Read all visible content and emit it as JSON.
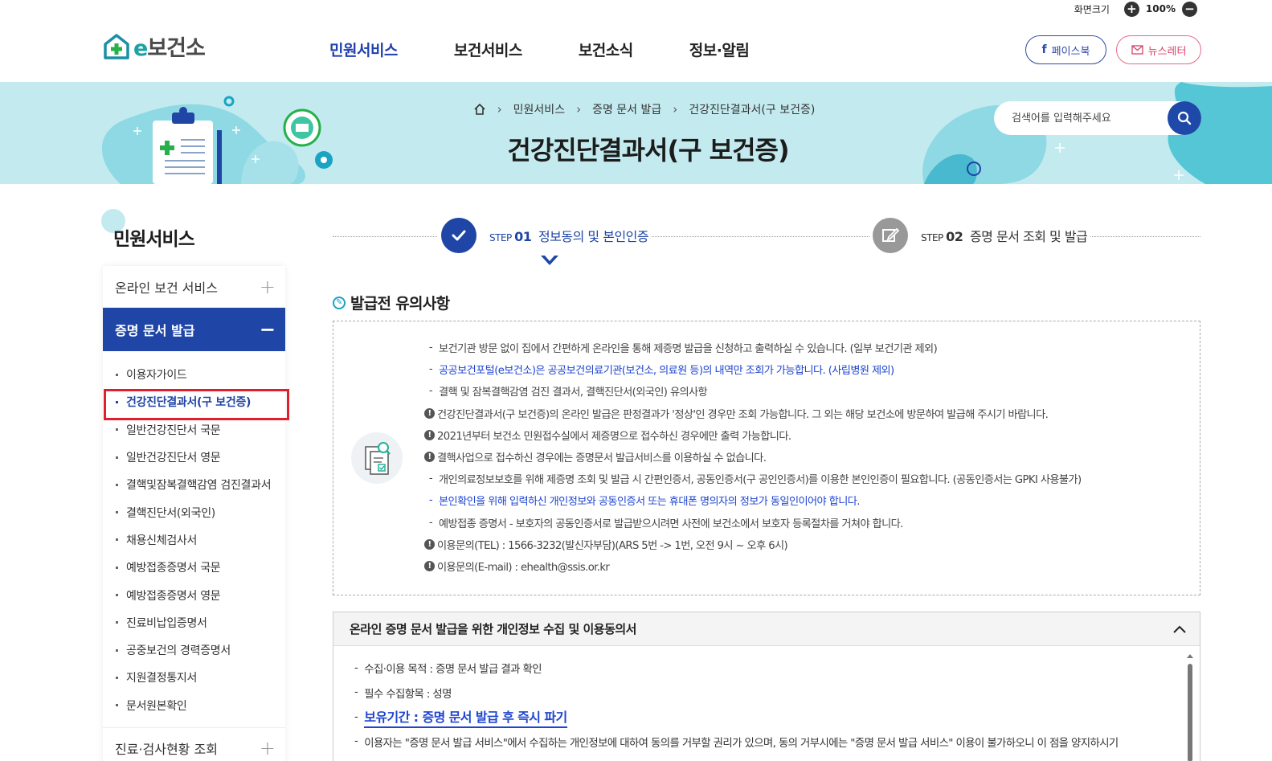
{
  "utility": {
    "screen_size_label": "화면크기",
    "zoom_value": "100%"
  },
  "header": {
    "logo_e": "e",
    "logo_text": "보건소",
    "nav": [
      "민원서비스",
      "보건서비스",
      "보건소식",
      "정보·알림"
    ],
    "facebook_label": "페이스북",
    "newsletter_label": "뉴스레터"
  },
  "banner": {
    "breadcrumb": [
      "민원서비스",
      "증명 문서 발급",
      "건강진단결과서(구 보건증)"
    ],
    "title": "건강진단결과서(구 보건증)",
    "search_placeholder": "검색어를 입력해주세요"
  },
  "sidebar": {
    "title": "민원서비스",
    "groups": [
      {
        "label": "온라인 보건 서비스",
        "toggle": "+"
      },
      {
        "label": "증명 문서 발급",
        "toggle": "−"
      },
      {
        "label": "진료·검사현황 조회",
        "toggle": "+"
      }
    ],
    "items": [
      "이용자가이드",
      "건강진단결과서(구 보건증)",
      "일반건강진단서 국문",
      "일반건강진단서 영문",
      "결핵및잠복결핵감염 검진결과서",
      "결핵진단서(외국인)",
      "채용신체검사서",
      "예방접종증명서 국문",
      "예방접종증명서 영문",
      "진료비납입증명서",
      "공중보건의 경력증명서",
      "지원결정통지서",
      "문서원본확인"
    ]
  },
  "steps": [
    {
      "prefix": "STEP",
      "num": "01",
      "label": "정보동의 및 본인인증"
    },
    {
      "prefix": "STEP",
      "num": "02",
      "label": "증명 문서 조회 및 발급"
    }
  ],
  "notice": {
    "title": "발급전 유의사항",
    "items": [
      "보건기관 방문 없이 집에서 간편하게 온라인을 통해 제증명 발급을 신청하고 출력하실 수 있습니다. (일부 보건기관 제외)",
      "공공보건포털(e보건소)은 공공보건의료기관(보건소, 의료원 등)의 내역만 조회가 가능합니다. (사립병원 제외)",
      "결핵 및 잠복결핵감염 검진 결과서, 결핵진단서(외국인) 유의사항",
      "건강진단결과서(구 보건증)의 온라인 발급은 판정결과가 '정상'인 경우만 조회 가능합니다. 그 외는 해당 보건소에 방문하여 발급해 주시기 바랍니다.",
      "2021년부터 보건소 민원접수실에서 제증명으로 접수하신 경우에만 출력 가능합니다.",
      "결핵사업으로 접수하신 경우에는 증명문서 발급서비스를 이용하실 수 없습니다.",
      "개인의료정보보호를 위해 제증명 조회 및 발급 시 간편인증서, 공동인증서(구 공인인증서)를 이용한 본인인증이 필요합니다. (공동인증서는 GPKI 사용불가)",
      "본인확인을 위해 입력하신 개인정보와 공동인증서 또는 휴대폰 명의자의 정보가 동일인이어야 합니다.",
      "예방접종 증명서 - 보호자의 공동인증서로 발급받으시려면 사전에 보건소에서 보호자 등록절차를 거쳐야 합니다.",
      "이용문의(TEL) : 1566-3232(발신자부담)(ARS 5번 -> 1번, 오전 9시 ~ 오후 6시)",
      "이용문의(E-mail) : ehealth@ssis.or.kr"
    ],
    "markers": [
      "-",
      "-",
      "-",
      "!",
      "!",
      "!",
      "-",
      "-",
      "-",
      "!",
      "!"
    ]
  },
  "consent": {
    "title": "온라인 증명 문서 발급을 위한 개인정보 수집 및 이용동의서",
    "items": [
      "수집·이용 목적 : 증명 문서 발급 결과 확인",
      "필수 수집항목 : 성명",
      "보유기간 : 증명 문서 발급 후 즉시 파기",
      "이용자는 \"증명 문서 발급 서비스\"에서 수집하는 개인정보에 대하여 동의를 거부할 권리가 있으며, 동의 거부시에는 \"증명 문서 발급 서비스\" 이용이 불가하오니 이 점을 양지하시기"
    ]
  },
  "colors": {
    "primary": "#1f45a6",
    "banner_bg": "#c3ebef",
    "highlight_box": "#e01e2e",
    "link_blue": "#1f45d0"
  }
}
